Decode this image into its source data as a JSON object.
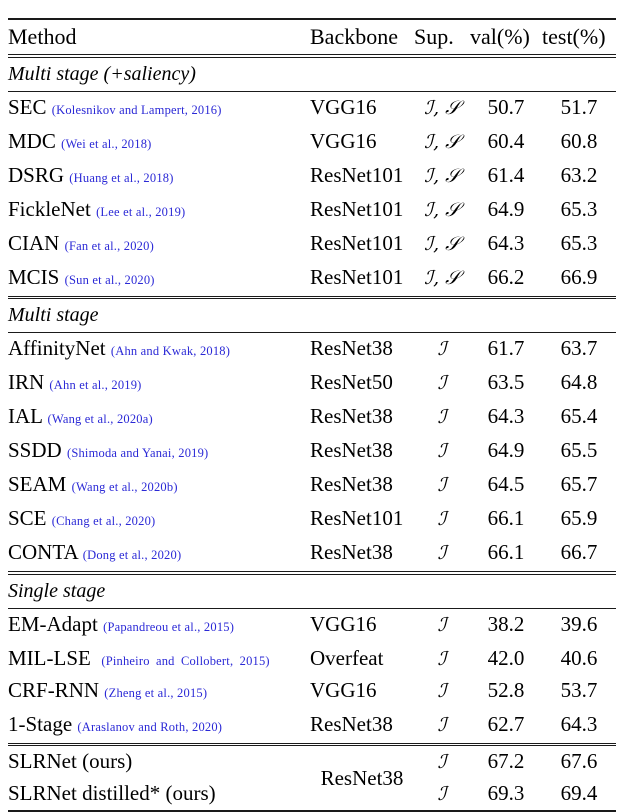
{
  "table": {
    "columns": [
      "Method",
      "Backbone",
      "Sup.",
      "val(%)",
      "test(%)"
    ],
    "symbols": {
      "image_level": "ℐ",
      "saliency": "ℐ, 𝒮"
    },
    "citation_color": "#2b29d6",
    "sections": [
      {
        "id": "multi-stage-saliency",
        "title": "Multi stage (+saliency)",
        "rows": [
          {
            "method": "SEC",
            "cite": "(Kolesnikov and Lampert, 2016)",
            "backbone": "VGG16",
            "sup": "ℐ, 𝒮",
            "val": "50.7",
            "test": "51.7"
          },
          {
            "method": "MDC",
            "cite": "(Wei et al., 2018)",
            "backbone": "VGG16",
            "sup": "ℐ, 𝒮",
            "val": "60.4",
            "test": "60.8"
          },
          {
            "method": "DSRG",
            "cite": "(Huang et al., 2018)",
            "backbone": "ResNet101",
            "sup": "ℐ, 𝒮",
            "val": "61.4",
            "test": "63.2"
          },
          {
            "method": "FickleNet",
            "cite": "(Lee et al., 2019)",
            "backbone": "ResNet101",
            "sup": "ℐ, 𝒮",
            "val": "64.9",
            "test": "65.3"
          },
          {
            "method": "CIAN",
            "cite": "(Fan et al., 2020)",
            "backbone": "ResNet101",
            "sup": "ℐ, 𝒮",
            "val": "64.3",
            "test": "65.3"
          },
          {
            "method": "MCIS",
            "cite": "(Sun et al., 2020)",
            "backbone": "ResNet101",
            "sup": "ℐ, 𝒮",
            "val": "66.2",
            "test": "66.9"
          }
        ]
      },
      {
        "id": "multi-stage",
        "title": "Multi stage",
        "rows": [
          {
            "method": "AffinityNet",
            "cite": "(Ahn and Kwak, 2018)",
            "backbone": "ResNet38",
            "sup": "ℐ",
            "val": "61.7",
            "test": "63.7"
          },
          {
            "method": "IRN",
            "cite": "(Ahn et al., 2019)",
            "backbone": "ResNet50",
            "sup": "ℐ",
            "val": "63.5",
            "test": "64.8"
          },
          {
            "method": "IAL",
            "cite": "(Wang et al., 2020a)",
            "backbone": "ResNet38",
            "sup": "ℐ",
            "val": "64.3",
            "test": "65.4"
          },
          {
            "method": "SSDD",
            "cite": "(Shimoda and Yanai, 2019)",
            "backbone": "ResNet38",
            "sup": "ℐ",
            "val": "64.9",
            "test": "65.5"
          },
          {
            "method": "SEAM",
            "cite": "(Wang et al., 2020b)",
            "backbone": "ResNet38",
            "sup": "ℐ",
            "val": "64.5",
            "test": "65.7"
          },
          {
            "method": "SCE",
            "cite": "(Chang et al., 2020)",
            "backbone": "ResNet101",
            "sup": "ℐ",
            "val": "66.1",
            "test": "65.9"
          },
          {
            "method": "CONTA",
            "cite": "(Dong et al., 2020)",
            "backbone": "ResNet38",
            "sup": "ℐ",
            "val": "66.1",
            "test": "66.7"
          }
        ]
      },
      {
        "id": "single-stage",
        "title": "Single stage",
        "rows": [
          {
            "method": "EM-Adapt",
            "cite": "(Papandreou et al., 2015)",
            "backbone": "VGG16",
            "sup": "ℐ",
            "val": "38.2",
            "test": "39.6"
          },
          {
            "method": "MIL-LSE",
            "cite": "(Pinheiro and Collobert, 2015)",
            "backbone": "Overfeat",
            "sup": "ℐ",
            "val": "42.0",
            "test": "40.6",
            "wrapped": true
          },
          {
            "method": "CRF-RNN",
            "cite": "(Zheng et al., 2015)",
            "backbone": "VGG16",
            "sup": "ℐ",
            "val": "52.8",
            "test": "53.7"
          },
          {
            "method": "1-Stage",
            "cite": "(Araslanov and Roth, 2020)",
            "backbone": "ResNet38",
            "sup": "ℐ",
            "val": "62.7",
            "test": "64.3"
          }
        ]
      }
    ],
    "ours": {
      "backbone": "ResNet38",
      "rows": [
        {
          "method": "SLRNet (ours)",
          "sup": "ℐ",
          "val": "67.2",
          "test": "67.6"
        },
        {
          "method": "SLRNet distilled* (ours)",
          "sup": "ℐ",
          "val": "69.3",
          "test": "69.4"
        }
      ]
    }
  }
}
